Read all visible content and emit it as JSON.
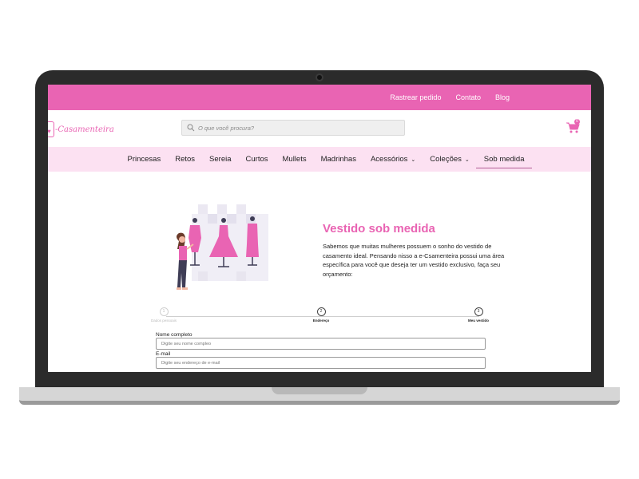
{
  "topbar": {
    "links": [
      "Rastrear pedido",
      "Contato",
      "Blog"
    ]
  },
  "header": {
    "logo_text": "-Casamenteira",
    "search_placeholder": "O que você procura?",
    "cart_count": "0"
  },
  "nav": {
    "items": [
      {
        "label": "Princesas"
      },
      {
        "label": "Retos"
      },
      {
        "label": "Sereia"
      },
      {
        "label": "Curtos"
      },
      {
        "label": "Mullets"
      },
      {
        "label": "Madrinhas"
      },
      {
        "label": "Acessórios"
      },
      {
        "label": "Coleções"
      },
      {
        "label": "Sob medida"
      }
    ],
    "active": "Sob medida"
  },
  "hero": {
    "title": "Vestido sob medida",
    "text": "Sabemos que muitas mulheres possuem o sonho do vestido de casamento ideal. Pensando nisso a e-Csamenteira possui uma área específica para você que deseja ter um vestido exclusivo, faça seu orçamento:"
  },
  "stepper": {
    "steps": [
      {
        "number": "1",
        "label": "Dados pessoais"
      },
      {
        "number": "2",
        "label": "Endereço"
      },
      {
        "number": "3",
        "label": "Meu vestido"
      }
    ]
  },
  "form": {
    "name_label": "Nome completo",
    "name_placeholder": "Digite seu nome compleo",
    "email_label": "E-mail",
    "email_placeholder": "Digite seu endereço de e-mail"
  },
  "colors": {
    "brand_pink": "#e964b3",
    "nav_bg": "#fce1f2",
    "laptop_frame": "#2b2b2b"
  }
}
